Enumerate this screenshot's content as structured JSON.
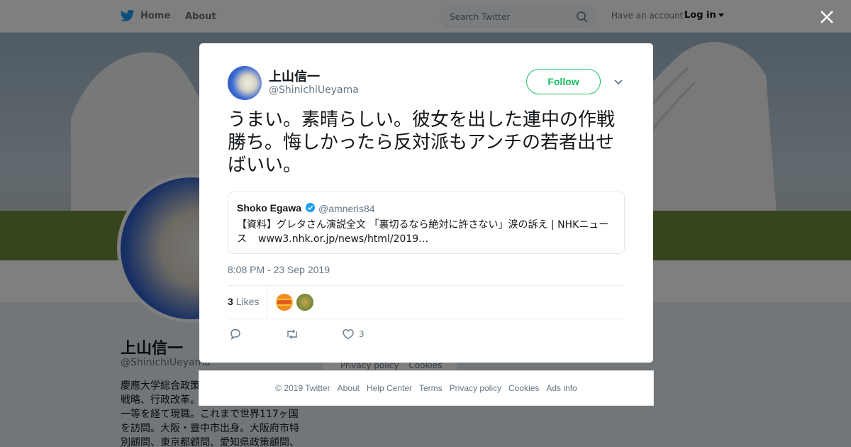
{
  "topbar": {
    "home_label": "Home",
    "about_label": "About",
    "search_placeholder": "Search Twitter",
    "account_prompt": "Have an account?",
    "login_label": "Log in"
  },
  "profile": {
    "name": "上山信一",
    "handle": "@ShinichiUeyama",
    "bio_lines": [
      "慶應大学総合政策",
      "戦略、行政改革。",
      "一等を経て現職。これまで世界117ヶ国",
      "を訪問。大阪・豊中市出身。大阪府市特",
      "別顧問、東京都顧問、愛知県政策顧問、"
    ],
    "footer_links": [
      "Privacy policy",
      "Cookies"
    ]
  },
  "tweet": {
    "author_name": "上山信一",
    "author_handle": "@ShinichiUeyama",
    "follow_label": "Follow",
    "text": "うまい。素晴らしい。彼女を出した連中の作戦勝ち。悔しかったら反対派もアンチの若者出せばいい。",
    "quote": {
      "name": "Shoko Egawa",
      "handle": "@amneris84",
      "text": "【資料】グレタさん演説全文 「裏切るなら絶対に許さない」涙の訴え | NHKニュース",
      "url": "www3.nhk.or.jp/news/html/2019…"
    },
    "timestamp": "8:08 PM - 23 Sep 2019",
    "likes_count": "3",
    "likes_label": "Likes",
    "actions": {
      "reply_count": "",
      "retweet_count": "",
      "like_count": "3"
    }
  },
  "footer": {
    "links": [
      "© 2019 Twitter",
      "About",
      "Help Center",
      "Terms",
      "Privacy policy",
      "Cookies",
      "Ads info"
    ]
  },
  "colors": {
    "follow_green": "#17bf63",
    "twitter_blue": "#1da1f2",
    "secondary_text": "#657786"
  }
}
